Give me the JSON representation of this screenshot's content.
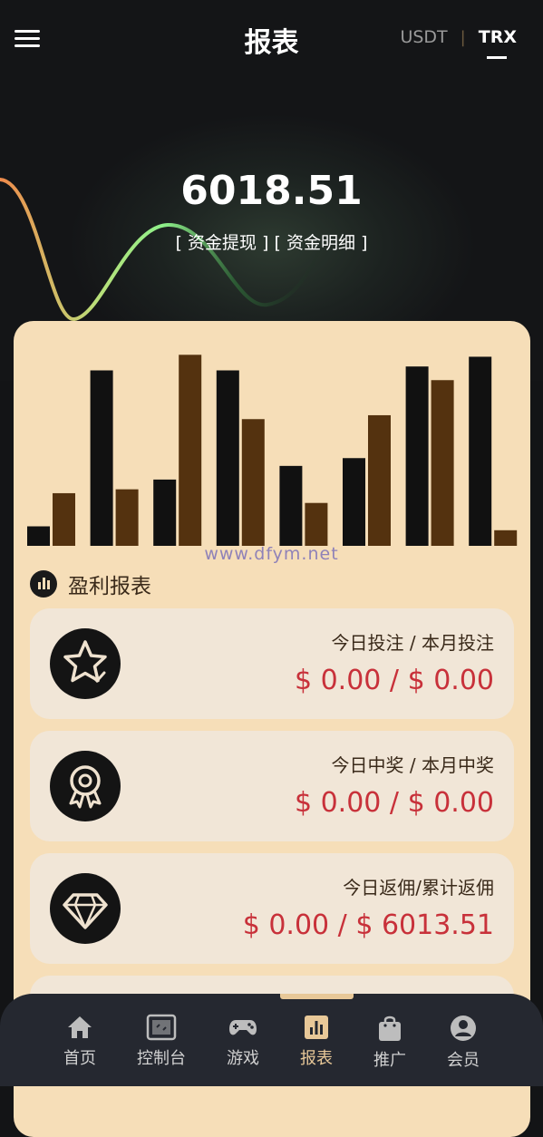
{
  "header": {
    "title": "报表",
    "currency_options": [
      "USDT",
      "TRX"
    ],
    "separator": "|",
    "active_currency": "TRX"
  },
  "balance": {
    "amount": "6018.51",
    "links": [
      "[ 资金提现 ]",
      "[ 资金明细 ]"
    ]
  },
  "chart_data": {
    "type": "bar",
    "categories": [
      "",
      "",
      "",
      "",
      "",
      "",
      "",
      ""
    ],
    "series": [
      {
        "color": "#111111",
        "values": [
          10,
          90,
          34,
          90,
          41,
          45,
          92,
          97
        ]
      },
      {
        "color": "#54320f",
        "values": [
          27,
          29,
          98,
          65,
          22,
          67,
          85,
          8
        ]
      }
    ],
    "ylim": [
      0,
      100
    ],
    "grid": false
  },
  "watermark": "www.dfym.net",
  "section": {
    "title": "盈利报表",
    "icon": "bar-chart-icon"
  },
  "stats": [
    {
      "icon": "star-badge-icon",
      "label": "今日投注 / 本月投注",
      "value": "$ 0.00 / $ 0.00"
    },
    {
      "icon": "award-medal-icon",
      "label": "今日中奖 / 本月中奖",
      "value": "$ 0.00 / $ 0.00"
    },
    {
      "icon": "diamond-icon",
      "label": "今日返佣/累计返佣",
      "value": "$ 0.00 / $ 6013.51"
    }
  ],
  "nav": {
    "active": "报表",
    "items": [
      {
        "icon": "home-icon",
        "label": "首页"
      },
      {
        "icon": "console-icon",
        "label": "控制台"
      },
      {
        "icon": "gamepad-icon",
        "label": "游戏"
      },
      {
        "icon": "report-icon",
        "label": "报表"
      },
      {
        "icon": "shopping-bag-icon",
        "label": "推广"
      },
      {
        "icon": "user-circle-icon",
        "label": "会员"
      }
    ]
  },
  "colors": {
    "background": "#131416",
    "card": "#f6deb8",
    "stat_card": "#f1e6d7",
    "value_red": "#c8313a",
    "nav_bg": "#252830",
    "nav_active": "#e8c898",
    "bar_dark": "#111111",
    "bar_brown": "#54320f"
  }
}
